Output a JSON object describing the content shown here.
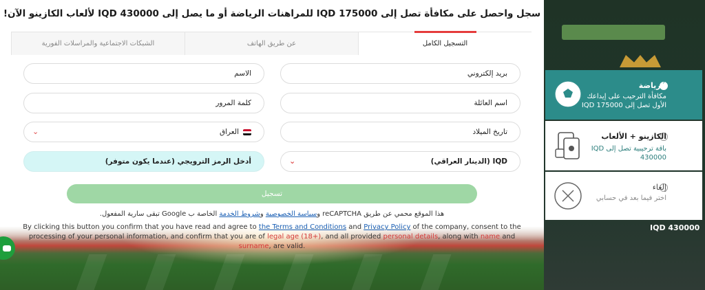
{
  "title": "سجل واحصل على مكافأة تصل إلى IQD 175000 للمراهنات الرياضة أو ما يصل إلى IQD 430000 لألعاب الكازينو الآن!",
  "tabs": [
    {
      "label": "التسجيل الكامل",
      "active": true
    },
    {
      "label": "عن طريق الهاتف",
      "active": false
    },
    {
      "label": "الشبكات الاجتماعية والمراسلات الفورية",
      "active": false
    }
  ],
  "form": {
    "email_placeholder": "بريد إلكتروني",
    "first_name_placeholder": "الاسم",
    "last_name_placeholder": "اسم العائلة",
    "password_placeholder": "كلمة المرور",
    "birthdate_placeholder": "تاريخ الميلاد",
    "country_value": "العراق",
    "currency_value": "IQD (الدينار العراقي)",
    "promo_placeholder": "أدخل الرمز الترويجي (عندما يكون متوفر)"
  },
  "register_label": "تسجيل",
  "legal_recaptcha": {
    "prefix": "هذا الموقع محمي عن طريق reCAPTCHA و",
    "privacy": "سياسة الخصوصية",
    "and": " و",
    "terms": "شروط الخدمة",
    "suffix": " الخاصة ب Google تبقى سارية المفعول."
  },
  "legal_en": {
    "p1": "By clicking this button you confirm that you have read and agree to ",
    "terms": "the Terms and Conditions",
    "p2": " and ",
    "privacy": "Privacy Policy",
    "p3": " of the company, consent to the processing of your personal information, and confirm that you are of ",
    "legal_age": "legal age (18+)",
    "p4": ", and all provided ",
    "personal_details": "personal details",
    "p5": ", along with ",
    "name": "name",
    "p6": " and ",
    "surname": "surname",
    "p7": ", are valid."
  },
  "bonuses": [
    {
      "name": "الرياضة",
      "desc": "مكافأة الترحيب على إيداعك الأول تصل إلى IQD 175000",
      "icon": "soccer-ball-icon",
      "selected": true
    },
    {
      "name": "الكازينو + الألعاب",
      "desc": "باقة ترحيبية تصل إلى IQD 430000",
      "icon": "casino-cards-icon",
      "selected": false
    },
    {
      "name": "إلغاء",
      "desc": "اختر فيما بعد في حسابي",
      "icon": "cancel-circle-icon",
      "selected": false
    }
  ],
  "background_amount": "IQD 430000",
  "colors": {
    "accent": "#e53b3b",
    "teal": "#2c8c8a",
    "register_button": "#9fd7a5",
    "promo_field": "#d5f6f6"
  }
}
